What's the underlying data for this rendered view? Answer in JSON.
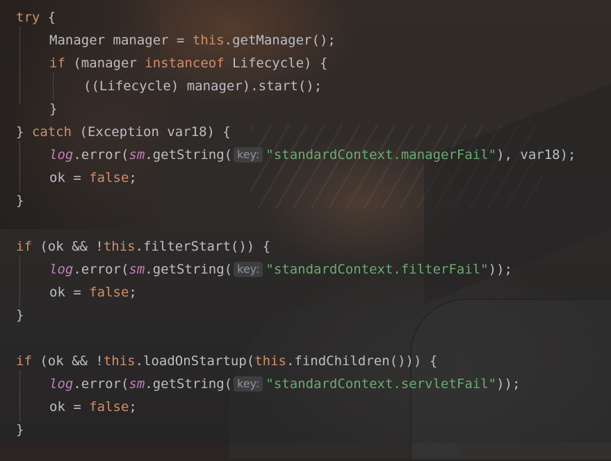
{
  "code": {
    "l1": {
      "try": "try",
      "brace": " {"
    },
    "l2": {
      "text": "Manager manager = ",
      "this": "this",
      "call": ".getManager();"
    },
    "l3": {
      "if": "if",
      "a": " (manager ",
      "instanceof": "instanceof",
      "b": " Lifecycle) {"
    },
    "l4": {
      "text": "((Lifecycle) manager).start();"
    },
    "l5": {
      "text": "}"
    },
    "l6": {
      "a": "} ",
      "catch": "catch",
      "b": " (Exception var18) {"
    },
    "l7": {
      "log": "log",
      "a": ".error(",
      "sm": "sm",
      "b": ".getString(",
      "hint": "key:",
      "str": "\"standardContext.managerFail\"",
      "c": "), var18);"
    },
    "l8": {
      "a": "ok = ",
      "false": "false",
      "b": ";"
    },
    "l9": {
      "text": "}"
    },
    "l11": {
      "if": "if",
      "a": " (ok && !",
      "this": "this",
      "b": ".filterStart()) {"
    },
    "l12": {
      "log": "log",
      "a": ".error(",
      "sm": "sm",
      "b": ".getString(",
      "hint": "key:",
      "str": "\"standardContext.filterFail\"",
      "c": "));"
    },
    "l13": {
      "a": "ok = ",
      "false": "false",
      "b": ";"
    },
    "l14": {
      "text": "}"
    },
    "l16": {
      "if": "if",
      "a": " (ok && !",
      "this": "this",
      "b": ".loadOnStartup(",
      "this2": "this",
      "c": ".findChildren())) {"
    },
    "l17": {
      "log": "log",
      "a": ".error(",
      "sm": "sm",
      "b": ".getString(",
      "hint": "key:",
      "str": "\"standardContext.servletFail\"",
      "c": "));"
    },
    "l18": {
      "a": "ok = ",
      "false": "false",
      "b": ";"
    },
    "l19": {
      "text": "}"
    }
  }
}
